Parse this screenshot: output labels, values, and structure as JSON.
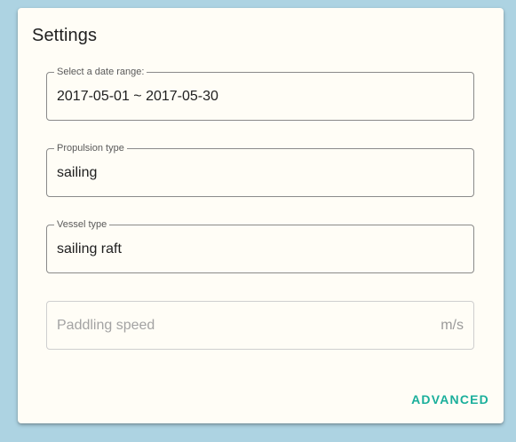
{
  "card": {
    "title": "Settings"
  },
  "fields": {
    "date_range": {
      "label": "Select a date range:",
      "value": "2017-05-01 ~ 2017-05-30"
    },
    "propulsion_type": {
      "label": "Propulsion type",
      "value": "sailing"
    },
    "vessel_type": {
      "label": "Vessel type",
      "value": "sailing raft"
    },
    "paddling_speed": {
      "placeholder": "Paddling speed",
      "unit": "m/s"
    }
  },
  "actions": {
    "advanced_label": "ADVANCED"
  },
  "colors": {
    "page_background": "#add3e2",
    "card_background": "#fffdf6",
    "accent": "#1aaf9b"
  }
}
